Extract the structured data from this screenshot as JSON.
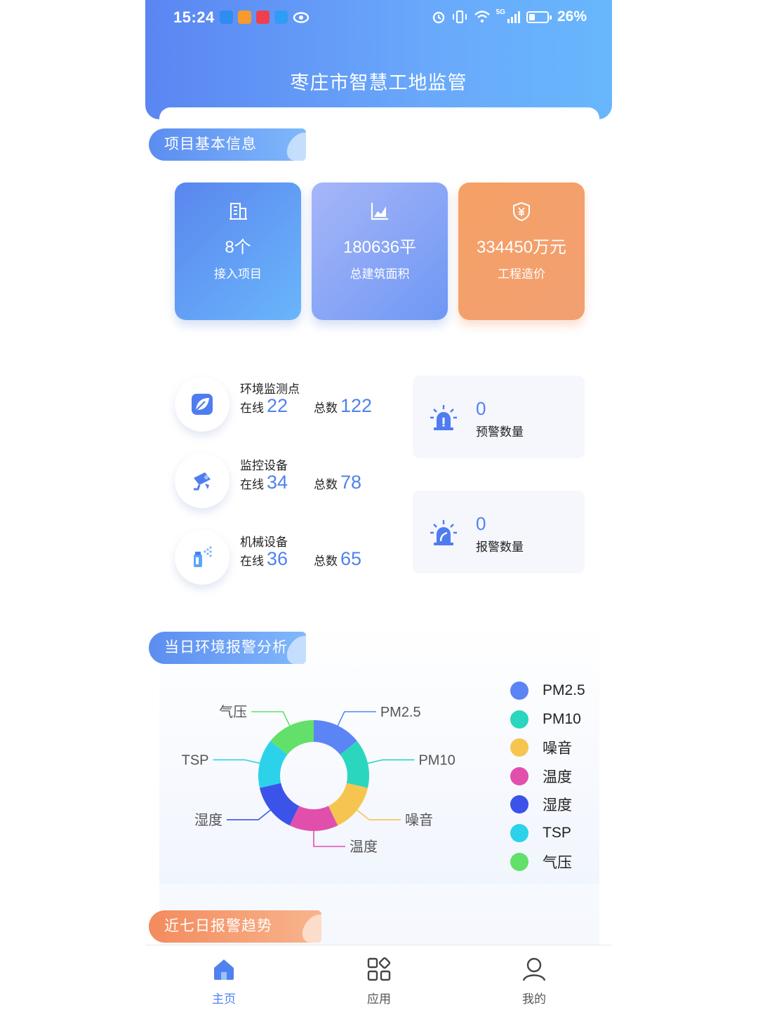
{
  "status_bar": {
    "time": "15:24",
    "network": "5G",
    "battery": "26%"
  },
  "header": {
    "title": "枣庄市智慧工地监管"
  },
  "sections": {
    "project_info": "项目基本信息",
    "env_alarm": "当日环境报警分析",
    "trend": "近七日报警趋势"
  },
  "stats": [
    {
      "value": "8个",
      "label": "接入项目",
      "icon": "building-icon"
    },
    {
      "value": "180636平",
      "label": "总建筑面积",
      "icon": "area-chart-icon"
    },
    {
      "value": "334450万元",
      "label": "工程造价",
      "icon": "yuan-shield-icon"
    }
  ],
  "devices": [
    {
      "name": "环境监测点",
      "online_label": "在线",
      "online": "22",
      "total_label": "总数",
      "total": "122",
      "icon": "leaf-icon"
    },
    {
      "name": "监控设备",
      "online_label": "在线",
      "online": "34",
      "total_label": "总数",
      "total": "78",
      "icon": "camera-icon"
    },
    {
      "name": "机械设备",
      "online_label": "在线",
      "online": "36",
      "total_label": "总数",
      "total": "65",
      "icon": "sprayer-icon"
    }
  ],
  "alarms": [
    {
      "value": "0",
      "label": "预警数量",
      "icon": "warning-light-icon"
    },
    {
      "value": "0",
      "label": "报警数量",
      "icon": "alarm-light-icon"
    }
  ],
  "chart_data": {
    "type": "pie",
    "donut": true,
    "categories": [
      "PM2.5",
      "PM10",
      "噪音",
      "温度",
      "湿度",
      "TSP",
      "气压"
    ],
    "values": [
      1,
      1,
      1,
      1,
      1,
      1,
      1
    ],
    "colors": [
      "#5b84f5",
      "#2ad6be",
      "#f6c54f",
      "#e14fad",
      "#3c53ea",
      "#2bd2ea",
      "#62e06a"
    ],
    "legend_position": "right"
  },
  "bottom_nav": [
    {
      "label": "主页",
      "icon": "home-icon",
      "active": true
    },
    {
      "label": "应用",
      "icon": "apps-icon",
      "active": false
    },
    {
      "label": "我的",
      "icon": "user-icon",
      "active": false
    }
  ]
}
